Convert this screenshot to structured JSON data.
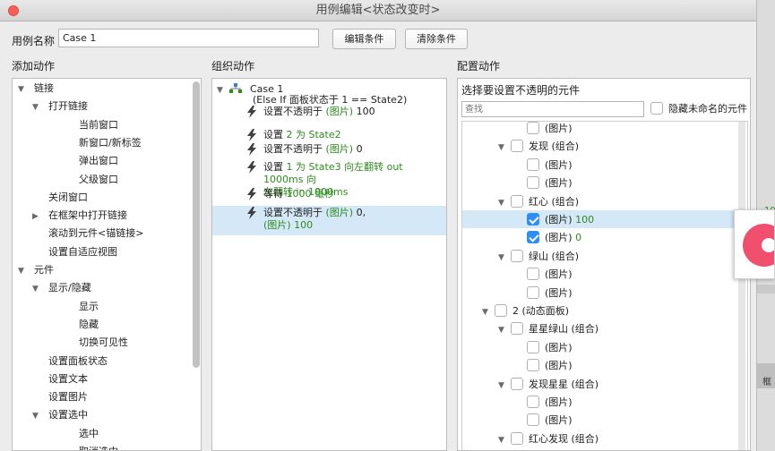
{
  "window": {
    "title": "用例编辑<状态改变时>"
  },
  "case_name": {
    "label": "用例名称",
    "value": "Case 1"
  },
  "buttons": {
    "edit_condition": "编辑条件",
    "clear_condition": "清除条件"
  },
  "columns": {
    "add_actions": "添加动作",
    "organize_actions": "组织动作",
    "configure_actions": "配置动作"
  },
  "add_actions_tree": [
    {
      "label": "链接",
      "indent": 0,
      "arrow": "down"
    },
    {
      "label": "打开链接",
      "indent": 1,
      "arrow": "down"
    },
    {
      "label": "当前窗口",
      "indent": 2,
      "arrow": ""
    },
    {
      "label": "新窗口/新标签",
      "indent": 2,
      "arrow": ""
    },
    {
      "label": "弹出窗口",
      "indent": 2,
      "arrow": ""
    },
    {
      "label": "父级窗口",
      "indent": 2,
      "arrow": ""
    },
    {
      "label": "关闭窗口",
      "indent": 1,
      "arrow": ""
    },
    {
      "label": "在框架中打开链接",
      "indent": 1,
      "arrow": "right"
    },
    {
      "label": "滚动到元件<锚链接>",
      "indent": 1,
      "arrow": ""
    },
    {
      "label": "设置自适应视图",
      "indent": 1,
      "arrow": ""
    },
    {
      "label": "元件",
      "indent": 0,
      "arrow": "down"
    },
    {
      "label": "显示/隐藏",
      "indent": 1,
      "arrow": "down"
    },
    {
      "label": "显示",
      "indent": 2,
      "arrow": ""
    },
    {
      "label": "隐藏",
      "indent": 2,
      "arrow": ""
    },
    {
      "label": "切换可见性",
      "indent": 2,
      "arrow": ""
    },
    {
      "label": "设置面板状态",
      "indent": 1,
      "arrow": ""
    },
    {
      "label": "设置文本",
      "indent": 1,
      "arrow": ""
    },
    {
      "label": "设置图片",
      "indent": 1,
      "arrow": ""
    },
    {
      "label": "设置选中",
      "indent": 1,
      "arrow": "down"
    },
    {
      "label": "选中",
      "indent": 2,
      "arrow": ""
    },
    {
      "label": "取消选中",
      "indent": 2,
      "arrow": ""
    }
  ],
  "organize": {
    "case_title": "Case 1",
    "case_condition": "(Else If 面板状态于 1 == State2)",
    "actions": [
      {
        "prefix": "设置不透明于 ",
        "green": "(图片)",
        "suffix": " 100",
        "line2": ""
      },
      {
        "prefix": "设置 ",
        "green": "2 为 State2",
        "suffix": "",
        "line2": ""
      },
      {
        "prefix": "设置不透明于 ",
        "green": "(图片)",
        "suffix": " 0",
        "line2": ""
      },
      {
        "prefix": "设置 ",
        "green": "1 为 State3 向左翻转 out 1000ms 向",
        "suffix": "",
        "line2": "左翻转 in 1000ms"
      },
      {
        "prefix": "等待 ",
        "green": "1000 毫秒",
        "suffix": "",
        "line2": ""
      },
      {
        "prefix": "设置不透明于 ",
        "green": "(图片)",
        "suffix": " 0,",
        "line2": "(图片) 100"
      }
    ]
  },
  "configure": {
    "heading": "选择要设置不透明的元件",
    "search_placeholder": "查找",
    "hide_unnamed": "隐藏未命名的元件",
    "items": [
      {
        "label": "(图片)",
        "value": "",
        "indent": 2,
        "arrow": "",
        "checked": false
      },
      {
        "label": "发现 (组合)",
        "value": "",
        "indent": 1,
        "arrow": "down",
        "checked": false
      },
      {
        "label": "(图片)",
        "value": "",
        "indent": 2,
        "arrow": "",
        "checked": false
      },
      {
        "label": "(图片)",
        "value": "",
        "indent": 2,
        "arrow": "",
        "checked": false
      },
      {
        "label": "红心 (组合)",
        "value": "",
        "indent": 1,
        "arrow": "down",
        "checked": false
      },
      {
        "label": "(图片)",
        "value": "100",
        "indent": 2,
        "arrow": "",
        "checked": true
      },
      {
        "label": "(图片)",
        "value": "0",
        "indent": 2,
        "arrow": "",
        "checked": true
      },
      {
        "label": "绿山 (组合)",
        "value": "",
        "indent": 1,
        "arrow": "down",
        "checked": false
      },
      {
        "label": "(图片)",
        "value": "",
        "indent": 2,
        "arrow": "",
        "checked": false
      },
      {
        "label": "(图片)",
        "value": "",
        "indent": 2,
        "arrow": "",
        "checked": false
      },
      {
        "label": "2 (动态面板)",
        "value": "",
        "indent": 0,
        "arrow": "down",
        "checked": false
      },
      {
        "label": "星星绿山 (组合)",
        "value": "",
        "indent": 1,
        "arrow": "down",
        "checked": false
      },
      {
        "label": "(图片)",
        "value": "",
        "indent": 2,
        "arrow": "",
        "checked": false
      },
      {
        "label": "(图片)",
        "value": "",
        "indent": 2,
        "arrow": "",
        "checked": false
      },
      {
        "label": "发现星星 (组合)",
        "value": "",
        "indent": 1,
        "arrow": "down",
        "checked": false
      },
      {
        "label": "(图片)",
        "value": "",
        "indent": 2,
        "arrow": "",
        "checked": false
      },
      {
        "label": "(图片)",
        "value": "",
        "indent": 2,
        "arrow": "",
        "checked": false
      },
      {
        "label": "红心发现 (组合)",
        "value": "",
        "indent": 1,
        "arrow": "down",
        "checked": false
      }
    ]
  },
  "background_text": {
    "right_value": "10",
    "right_char": "框"
  },
  "colors": {
    "accent_green": "#2e8b1f",
    "selection": "#d5e8f7",
    "checkbox_blue": "#2f8ef5",
    "close_red": "#fc5f57",
    "popup_icon": "#f0506e"
  },
  "icons": {
    "action": "bolt-icon",
    "case": "case-flow-icon",
    "close": "close-icon"
  }
}
